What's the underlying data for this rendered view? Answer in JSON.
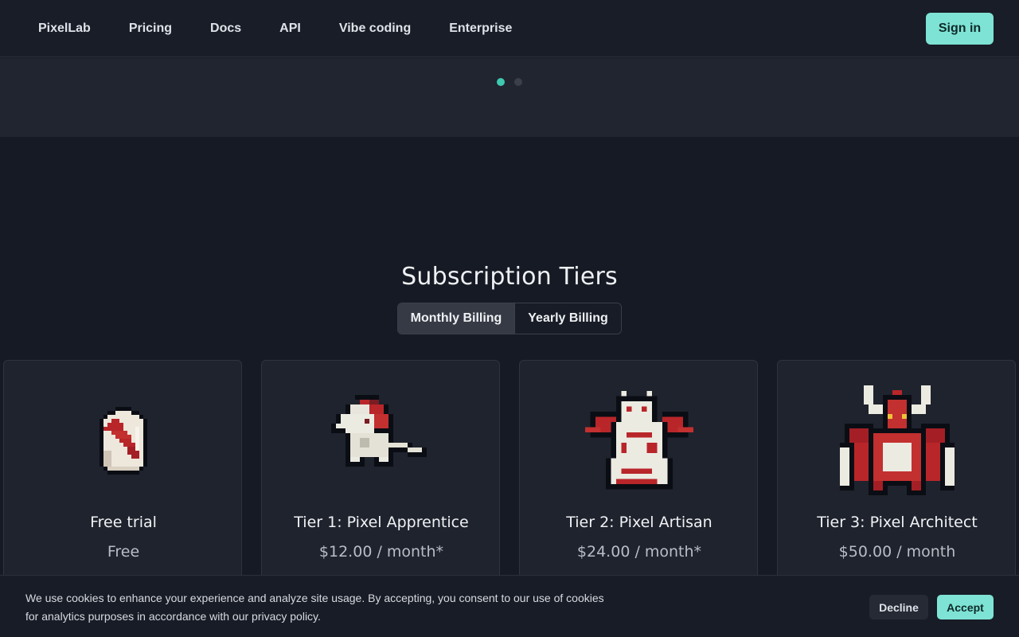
{
  "nav": {
    "brand": "PixelLab",
    "links": [
      "Pricing",
      "Docs",
      "API",
      "Vibe coding",
      "Enterprise"
    ],
    "signin_label": "Sign in"
  },
  "carousel": {
    "active_index": 0,
    "count": 2
  },
  "subscription": {
    "title": "Subscription Tiers",
    "billing": {
      "monthly_label": "Monthly Billing",
      "yearly_label": "Yearly Billing",
      "selected": "Monthly Billing"
    },
    "tiers": [
      {
        "name": "Free trial",
        "price": "Free",
        "icon": "egg-sprite-icon"
      },
      {
        "name": "Tier 1: Pixel Apprentice",
        "price": "$12.00 / month*",
        "icon": "white-dragon-sprite-icon"
      },
      {
        "name": "Tier 2: Pixel Artisan",
        "price": "$24.00 / month*",
        "icon": "winged-dragon-sprite-icon"
      },
      {
        "name": "Tier 3: Pixel Architect",
        "price": "$50.00 / month",
        "icon": "red-demon-dragon-sprite-icon"
      }
    ]
  },
  "cookie": {
    "line1": "We use cookies to enhance your experience and analyze site usage. By accepting, you consent to our use of cookies",
    "line2": "for analytics purposes in accordance with our privacy policy.",
    "decline_label": "Decline",
    "accept_label": "Accept"
  },
  "colors": {
    "accent": "#7ee3d4",
    "dot_active": "#3ec9b0",
    "background": "#161a24",
    "card": "#1f232d"
  }
}
